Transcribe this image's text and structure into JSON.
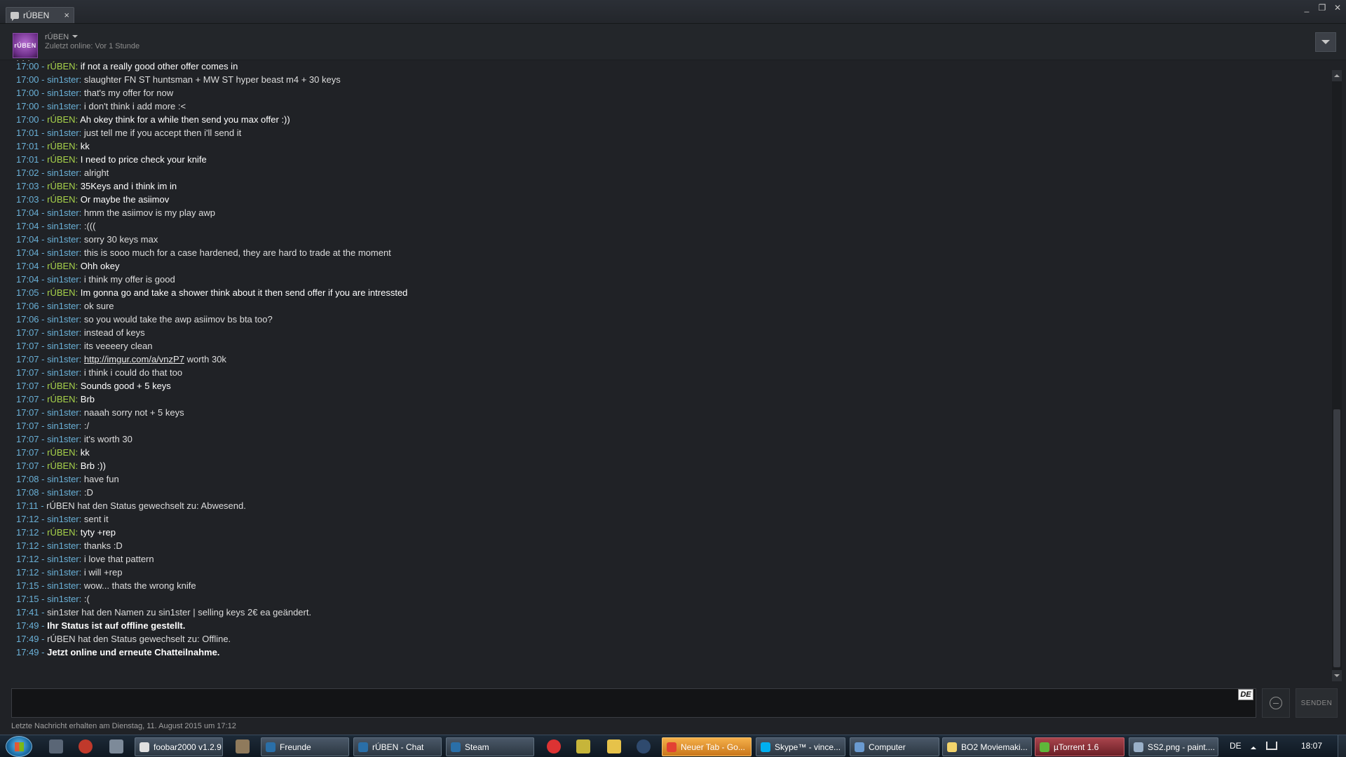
{
  "window": {
    "tab_title": "rÚBEN",
    "tab_close": "×",
    "minimize": "_",
    "maximize": "❐",
    "close": "✕"
  },
  "header": {
    "avatar_text": "rÚBEN",
    "friend_name": "rÚBEN",
    "status": "Zuletzt online: Vor 1 Stunde"
  },
  "chat": {
    "partial_line": "· · ·",
    "messages": [
      {
        "time": "17:00",
        "user": "rÚBEN",
        "text": "if not a really good other offer comes in"
      },
      {
        "time": "17:00",
        "user": "sin1ster",
        "text": "slaughter FN ST huntsman + MW ST hyper beast m4 + 30 keys"
      },
      {
        "time": "17:00",
        "user": "sin1ster",
        "text": "that's my offer for now"
      },
      {
        "time": "17:00",
        "user": "sin1ster",
        "text": "i don't think i add more :<"
      },
      {
        "time": "17:00",
        "user": "rÚBEN",
        "text": "Ah okey think for a while then send you max offer :))"
      },
      {
        "time": "17:01",
        "user": "sin1ster",
        "text": "just tell me if you accept then i'll send it"
      },
      {
        "time": "17:01",
        "user": "rÚBEN",
        "text": "kk"
      },
      {
        "time": "17:01",
        "user": "rÚBEN",
        "text": "I need to price check your knife"
      },
      {
        "time": "17:02",
        "user": "sin1ster",
        "text": "alright"
      },
      {
        "time": "17:03",
        "user": "rÚBEN",
        "text": "35Keys and i think im in"
      },
      {
        "time": "17:03",
        "user": "rÚBEN",
        "text": "Or maybe the asiimov"
      },
      {
        "time": "17:04",
        "user": "sin1ster",
        "text": "hmm the asiimov is my play awp"
      },
      {
        "time": "17:04",
        "user": "sin1ster",
        "text": ":((("
      },
      {
        "time": "17:04",
        "user": "sin1ster",
        "text": "sorry 30 keys max"
      },
      {
        "time": "17:04",
        "user": "sin1ster",
        "text": "this is sooo much for a case hardened, they are hard to trade at the moment"
      },
      {
        "time": "17:04",
        "user": "rÚBEN",
        "text": "Ohh okey"
      },
      {
        "time": "17:04",
        "user": "sin1ster",
        "text": "i think my offer is good"
      },
      {
        "time": "17:05",
        "user": "rÚBEN",
        "text": "Im gonna go and take a shower think about it then send offer if you are intressted"
      },
      {
        "time": "17:06",
        "user": "sin1ster",
        "text": "ok sure"
      },
      {
        "time": "17:06",
        "user": "sin1ster",
        "text": "so you would take the awp asiimov bs bta too?"
      },
      {
        "time": "17:07",
        "user": "sin1ster",
        "text": "instead of keys"
      },
      {
        "time": "17:07",
        "user": "sin1ster",
        "text": "its veeeery clean"
      },
      {
        "time": "17:07",
        "user": "sin1ster",
        "link": "http://imgur.com/a/vnzP7",
        "text": " worth 30k"
      },
      {
        "time": "17:07",
        "user": "sin1ster",
        "text": "i think i could do that too"
      },
      {
        "time": "17:07",
        "user": "rÚBEN",
        "text": "Sounds good + 5 keys"
      },
      {
        "time": "17:07",
        "user": "rÚBEN",
        "text": "Brb"
      },
      {
        "time": "17:07",
        "user": "sin1ster",
        "text": "naaah sorry not + 5 keys"
      },
      {
        "time": "17:07",
        "user": "sin1ster",
        "text": ":/"
      },
      {
        "time": "17:07",
        "user": "sin1ster",
        "text": "it's worth 30"
      },
      {
        "time": "17:07",
        "user": "rÚBEN",
        "text": "kk"
      },
      {
        "time": "17:07",
        "user": "rÚBEN",
        "text": "Brb :))"
      },
      {
        "time": "17:08",
        "user": "sin1ster",
        "text": "have fun"
      },
      {
        "time": "17:08",
        "user": "sin1ster",
        "text": ":D"
      },
      {
        "time": "17:11",
        "system": "rÚBEN hat den Status gewechselt zu: Abwesend."
      },
      {
        "time": "17:12",
        "user": "sin1ster",
        "text": "sent it"
      },
      {
        "time": "17:12",
        "user": "rÚBEN",
        "text": "tyty +rep"
      },
      {
        "time": "17:12",
        "user": "sin1ster",
        "text": "thanks :D"
      },
      {
        "time": "17:12",
        "user": "sin1ster",
        "text": "i love that pattern"
      },
      {
        "time": "17:12",
        "user": "sin1ster",
        "text": "i will +rep"
      },
      {
        "time": "17:15",
        "user": "sin1ster",
        "text": "wow... thats the wrong knife"
      },
      {
        "time": "17:15",
        "user": "sin1ster",
        "text": ":("
      },
      {
        "time": "17:41",
        "system": "sin1ster hat den Namen zu sin1ster | selling keys 2€ ea geändert."
      },
      {
        "time": "17:49",
        "system": "Ihr Status ist auf offline gestellt.",
        "bold": true
      },
      {
        "time": "17:49",
        "system": "rÚBEN hat den Status gewechselt zu: Offline."
      },
      {
        "time": "17:49",
        "system": "Jetzt online und erneute Chatteilnahme.",
        "bold": true
      }
    ]
  },
  "input": {
    "value": "",
    "lang": "DE",
    "send_label": "SENDEN"
  },
  "footer": {
    "last_received": "Letzte Nachricht erhalten am Dienstag, 11. August 2015 um 17:12"
  },
  "taskbar": {
    "tasks": [
      {
        "label": "foobar2000 v1.2.9",
        "color": "#e0e0e0",
        "style": ""
      },
      {
        "label": "Freunde",
        "color": "#2a6fa8",
        "style": ""
      },
      {
        "label": "rÚBEN - Chat",
        "color": "#2a6fa8",
        "style": ""
      },
      {
        "label": "Steam",
        "color": "#2a6fa8",
        "style": ""
      },
      {
        "label": "Neuer Tab - Go...",
        "color": "#e34133",
        "style": "orange"
      },
      {
        "label": "Skype™ - vince...",
        "color": "#00aff0",
        "style": ""
      },
      {
        "label": "Computer",
        "color": "#6a9ad0",
        "style": ""
      },
      {
        "label": "BO2 Moviemaki...",
        "color": "#f2d36b",
        "style": ""
      },
      {
        "label": "µTorrent 1.6",
        "color": "#5fb73a",
        "style": "red"
      },
      {
        "label": "SS2.png - paint....",
        "color": "#9ab0c8",
        "style": ""
      }
    ],
    "lang": "DE",
    "clock": "18:07"
  }
}
